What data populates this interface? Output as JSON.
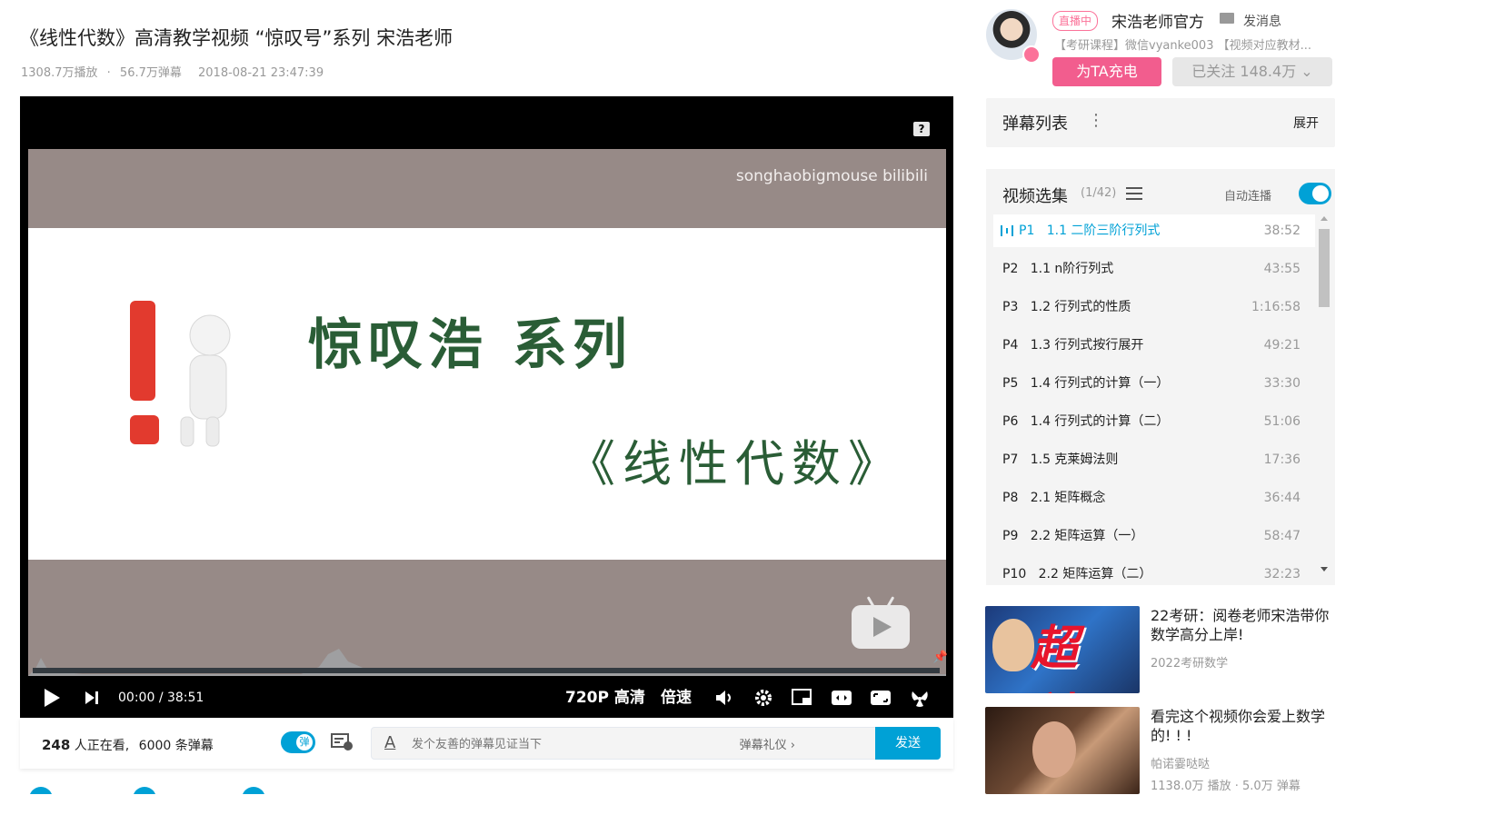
{
  "video": {
    "title": "《线性代数》高清教学视频 “惊叹号”系列 宋浩老师",
    "plays": "1308.7万播放",
    "danmaku": "56.7万弹幕",
    "date": "2018-08-21 23:47:39"
  },
  "player": {
    "watermark": "songhaobigmouse bilibili",
    "slide_title": "惊叹浩 系列",
    "slide_subtitle": "《线性代数》",
    "help_icon": "?",
    "current_time": "00:00",
    "separator": "/",
    "duration": "38:51",
    "quality": "720P 高清",
    "speed": "倍速",
    "progress": 0
  },
  "sendbar": {
    "viewers_count": "248",
    "viewers_text": "人正在看,",
    "danmaku_count": "6000 条弹幕",
    "toggle_label": "弹",
    "input_placeholder": "发个友善的弹幕见证当下",
    "etiquette": "弹幕礼仪 ›",
    "send": "发送",
    "a_icon": "A"
  },
  "uploader": {
    "live_badge": "直播中",
    "name": "宋浩老师官方",
    "message": "发消息",
    "description": "【考研课程】微信vyanke003 【视频对应教材...",
    "charge": "为TA充电",
    "follow": "已关注 148.4万 ⌄"
  },
  "danmaku_list": {
    "label": "弹幕列表",
    "menu": "⋮",
    "expand": "展开"
  },
  "playlist": {
    "title": "视频选集",
    "count": "(1/42)",
    "autoplay": "自动连播",
    "episodes": [
      {
        "no": "P1",
        "title": "1.1 二阶三阶行列式",
        "duration": "38:52"
      },
      {
        "no": "P2",
        "title": "1.1 n阶行列式",
        "duration": "43:55"
      },
      {
        "no": "P3",
        "title": "1.2 行列式的性质",
        "duration": "1:16:58"
      },
      {
        "no": "P4",
        "title": "1.3 行列式按行展开",
        "duration": "49:21"
      },
      {
        "no": "P5",
        "title": "1.4 行列式的计算（一）",
        "duration": "33:30"
      },
      {
        "no": "P6",
        "title": "1.4 行列式的计算（二）",
        "duration": "51:06"
      },
      {
        "no": "P7",
        "title": "1.5 克莱姆法则",
        "duration": "17:36"
      },
      {
        "no": "P8",
        "title": "2.1 矩阵概念",
        "duration": "36:44"
      },
      {
        "no": "P9",
        "title": "2.2 矩阵运算（一）",
        "duration": "58:47"
      },
      {
        "no": "P10",
        "title": "2.2 矩阵运算（二）",
        "duration": "32:23"
      }
    ]
  },
  "recommendations": [
    {
      "title": "22考研：阅卷老师宋浩带你数学高分上岸!",
      "line1": "2022考研数学",
      "line2": "",
      "thumb_text": "超神!"
    },
    {
      "title": "看完这个视频你会爱上数学的! ! !",
      "line1": "帕诺霎哒哒",
      "line2": "1138.0万 播放 · 5.0万 弹幕",
      "thumb_text": ""
    }
  ],
  "colors": {
    "accent": "#00a1d6",
    "pink": "#fb7299",
    "charge": "#f25d8e",
    "slide_bg": "#978a87",
    "slide_text": "#2a5d36"
  }
}
